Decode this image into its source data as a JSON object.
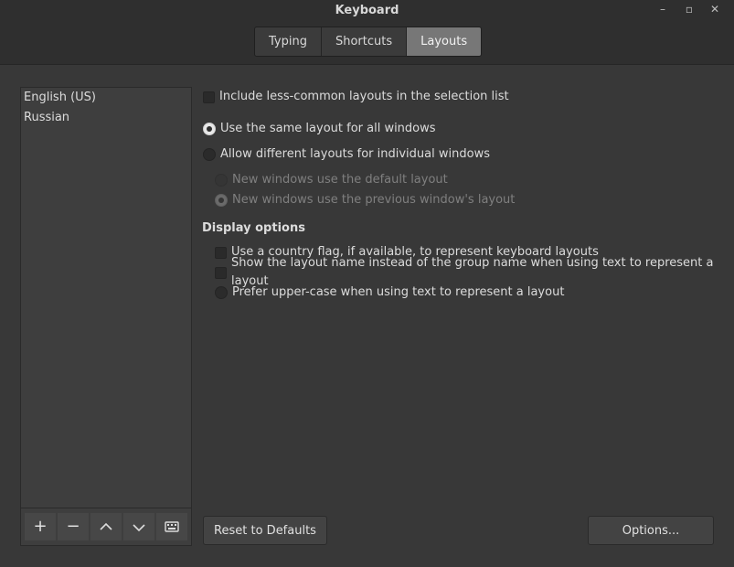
{
  "window": {
    "title": "Keyboard"
  },
  "controls": {
    "minimize": "–",
    "restore": "▫",
    "close": "✕"
  },
  "tabs": [
    {
      "label": "Typing",
      "active": false
    },
    {
      "label": "Shortcuts",
      "active": false
    },
    {
      "label": "Layouts",
      "active": true
    }
  ],
  "layouts": [
    "English (US)",
    "Russian"
  ],
  "options": {
    "include_less_common": "Include less-common layouts in the selection list",
    "same_layout": "Use the same layout for all windows",
    "different_layouts": "Allow different layouts for individual windows",
    "new_default": "New windows use the default layout",
    "new_previous": "New windows use the previous window's layout"
  },
  "display": {
    "heading": "Display options",
    "country_flag": "Use a country flag, if available,  to represent keyboard layouts",
    "layout_name": "Show the layout name instead of the group name when using text to represent a layout",
    "upper_case": "Prefer upper-case when using text to represent a layout"
  },
  "buttons": {
    "reset": "Reset to Defaults",
    "options": "Options..."
  },
  "toolbar": {
    "add": "+",
    "remove": "−"
  }
}
